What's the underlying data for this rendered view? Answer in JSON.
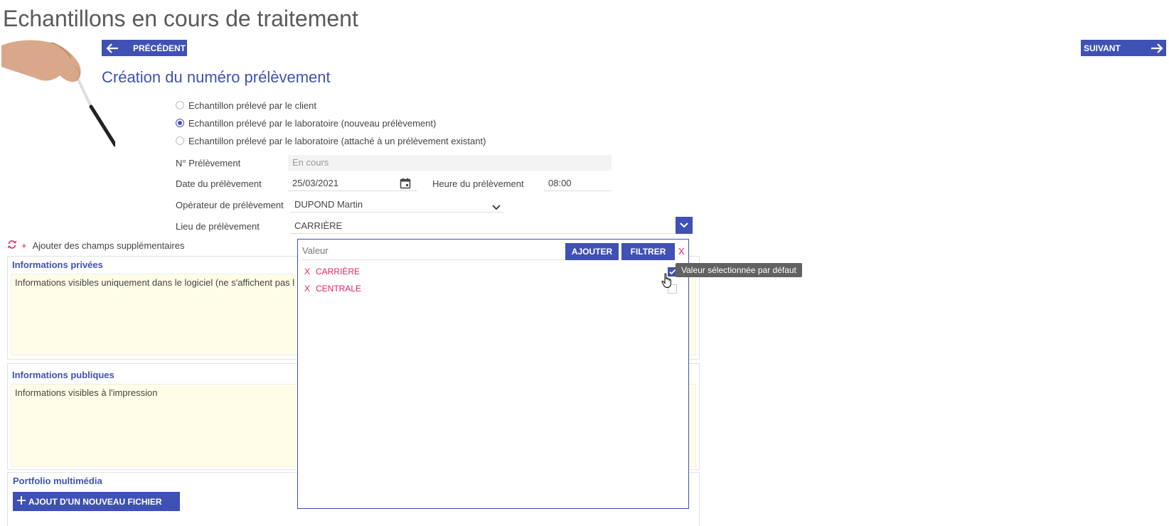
{
  "page": {
    "title": "Echantillons en cours de traitement",
    "prev_label": "PRÉCÉDENT",
    "next_label": "SUIVANT",
    "subtitle": "Création du numéro prélèvement"
  },
  "sampling_options": [
    {
      "label": "Echantillon prélevé par le client",
      "checked": false
    },
    {
      "label": "Echantillon prélevé par le laboratoire (nouveau prélèvement)",
      "checked": true
    },
    {
      "label": "Echantillon prélevé par le laboratoire (attaché à un prélèvement existant)",
      "checked": false
    }
  ],
  "form": {
    "sample_no_label": "N° Prélèvement",
    "sample_no_value": "En cours",
    "date_label": "Date du prélèvement",
    "date_value": "25/03/2021",
    "time_label": "Heure du prélèvement",
    "time_value": "08:00",
    "operator_label": "Opérateur de prélèvement",
    "operator_value": "DUPOND Martin",
    "location_label": "Lieu de prélèvement",
    "location_value": "CARRIÈRE"
  },
  "extra_fields": {
    "plus": "+",
    "label": "Ajouter des champs supplémentaires"
  },
  "sections": {
    "private_title": "Informations privées",
    "private_text": "Informations visibles uniquement dans le logiciel (ne s'affichent pas l",
    "public_title": "Informations publiques",
    "public_text": "Informations visibles à l'impression",
    "portfolio_title": "Portfolio multimédia",
    "add_file_label": "AJOUT D'UN NOUVEAU FICHIER"
  },
  "popup": {
    "value_placeholder": "Valeur",
    "add_label": "AJOUTER",
    "filter_label": "FILTRER",
    "close_label": "X",
    "items": [
      {
        "remove": "X",
        "label": "CARRIÈRE",
        "default": true
      },
      {
        "remove": "X",
        "label": "CENTRALE",
        "default": false
      }
    ],
    "tooltip": "Valeur sélectionnée par défaut"
  },
  "colors": {
    "accent": "#3f51b5",
    "pink": "#e91e63",
    "note_bg": "#fffde7"
  }
}
